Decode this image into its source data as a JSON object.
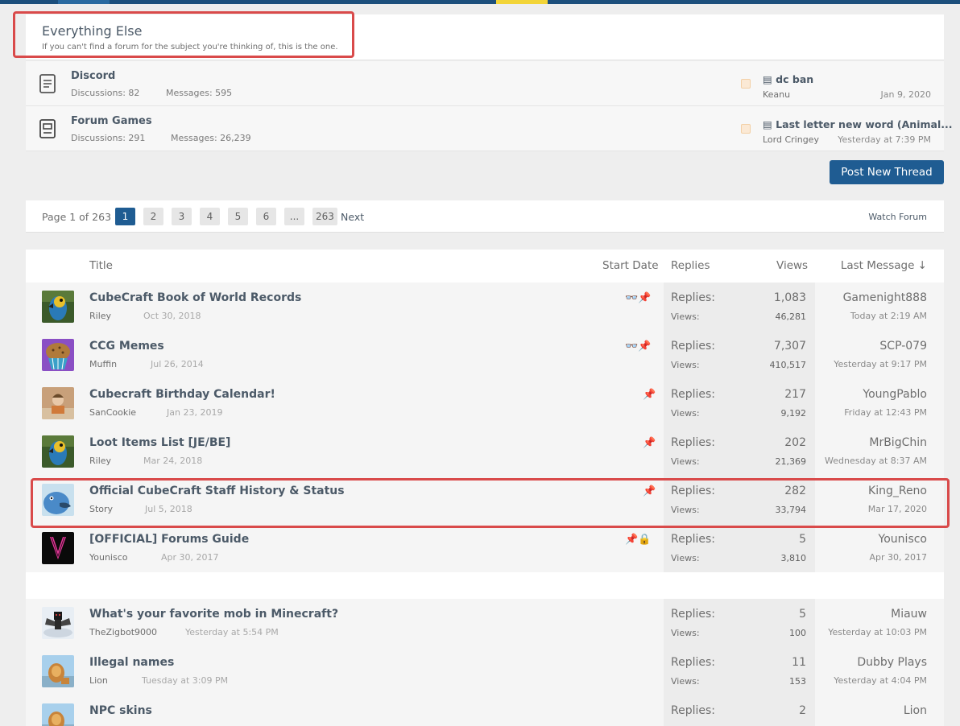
{
  "category": {
    "title": "Everything Else",
    "description": "If you can't find a forum for the subject you're thinking of, this is the one."
  },
  "nodes": [
    {
      "title": "Discord",
      "discussions": "Discussions: 82",
      "messages": "Messages: 595",
      "last_title": "dc ban",
      "last_user": "Keanu",
      "last_date": "Jan 9, 2020"
    },
    {
      "title": "Forum Games",
      "discussions": "Discussions: 291",
      "messages": "Messages: 26,239",
      "last_title": "Last letter new word (Animal...",
      "last_user": "Lord Cringey",
      "last_date": "Yesterday at 7:39 PM"
    }
  ],
  "post_button": "Post New Thread",
  "pager": {
    "label": "Page 1 of 263",
    "pages": [
      "1",
      "2",
      "3",
      "4",
      "5",
      "6",
      "...",
      "263"
    ],
    "next": "Next",
    "watch": "Watch Forum"
  },
  "columns": {
    "title": "Title",
    "start_date": "Start Date",
    "replies": "Replies",
    "views": "Views",
    "last_message": "Last Message ↓"
  },
  "labels": {
    "replies": "Replies:",
    "views": "Views:"
  },
  "threads": [
    {
      "title": "CubeCraft Book of World Records",
      "user": "Riley",
      "date": "Oct 30, 2018",
      "icons": "👓📌",
      "replies": "1,083",
      "views": "46,281",
      "last_user": "Gamenight888",
      "last_date": "Today at 2:19 AM",
      "avatar": "parrot"
    },
    {
      "title": "CCG Memes",
      "user": "Muffin",
      "date": "Jul 26, 2014",
      "icons": "👓📌",
      "replies": "7,307",
      "views": "410,517",
      "last_user": "SCP-079",
      "last_date": "Yesterday at 9:17 PM",
      "avatar": "muffin"
    },
    {
      "title": "Cubecraft Birthday Calendar!",
      "user": "SanCookie",
      "date": "Jan 23, 2019",
      "icons": "📌",
      "replies": "217",
      "views": "9,192",
      "last_user": "YoungPablo",
      "last_date": "Friday at 12:43 PM",
      "avatar": "person"
    },
    {
      "title": "Loot Items List [JE/BE]",
      "user": "Riley",
      "date": "Mar 24, 2018",
      "icons": "📌",
      "replies": "202",
      "views": "21,369",
      "last_user": "MrBigChin",
      "last_date": "Wednesday at 8:37 AM",
      "avatar": "parrot"
    },
    {
      "title": "Official CubeCraft Staff History & Status",
      "user": "Story",
      "date": "Jul 5, 2018",
      "icons": "📌",
      "replies": "282",
      "views": "33,794",
      "last_user": "King_Reno",
      "last_date": "Mar 17, 2020",
      "avatar": "bird"
    },
    {
      "title": "[OFFICIAL] Forums Guide",
      "user": "Younisco",
      "date": "Apr 30, 2017",
      "icons": "📌🔒",
      "replies": "5",
      "views": "3,810",
      "last_user": "Younisco",
      "last_date": "Apr 30, 2017",
      "avatar": "logo"
    },
    {
      "title": "What's your favorite mob in Minecraft?",
      "user": "TheZigbot9000",
      "date": "Yesterday at 5:54 PM",
      "icons": "",
      "replies": "5",
      "views": "100",
      "last_user": "Miauw",
      "last_date": "Yesterday at 10:03 PM",
      "avatar": "skin"
    },
    {
      "title": "Illegal names",
      "user": "Lion",
      "date": "Tuesday at 3:09 PM",
      "icons": "",
      "replies": "11",
      "views": "153",
      "last_user": "Dubby Plays",
      "last_date": "Yesterday at 4:04 PM",
      "avatar": "lion"
    },
    {
      "title": "NPC skins",
      "user": "",
      "date": "",
      "icons": "",
      "replies": "2",
      "views": "",
      "last_user": "Lion",
      "last_date": "",
      "avatar": "lion"
    }
  ]
}
